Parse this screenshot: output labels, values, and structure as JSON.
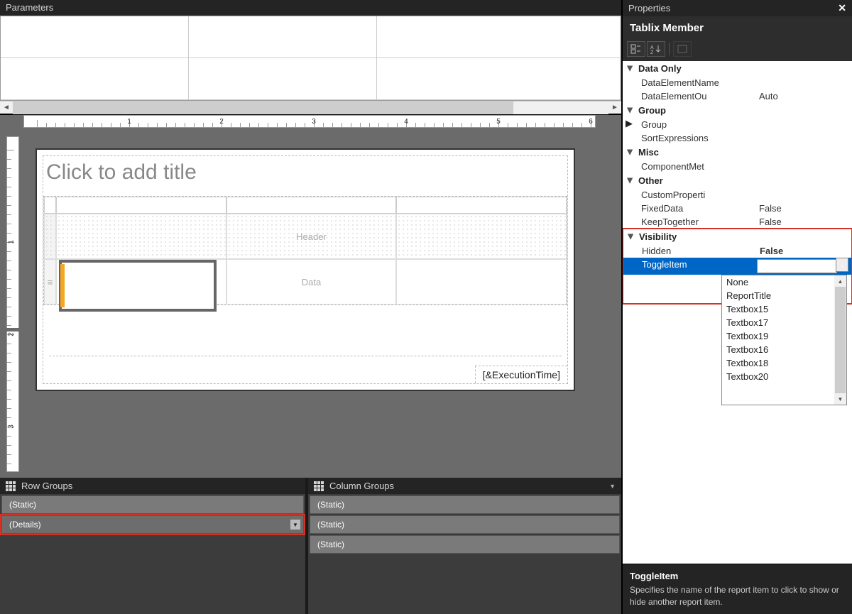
{
  "parameters": {
    "title": "Parameters"
  },
  "design": {
    "title_placeholder": "Click to add title",
    "header_label": "Header",
    "data_label": "Data",
    "exec_time": "[&ExecutionTime]"
  },
  "row_groups": {
    "title": "Row Groups",
    "items": [
      "(Static)",
      "(Details)"
    ]
  },
  "col_groups": {
    "title": "Column Groups",
    "items": [
      "(Static)",
      "(Static)",
      "(Static)"
    ]
  },
  "properties": {
    "title": "Properties",
    "object": "Tablix Member",
    "categories": [
      {
        "name": "Data Only",
        "open": true,
        "props": [
          {
            "k": "DataElementName",
            "v": ""
          },
          {
            "k": "DataElementOutput",
            "kshort": "DataElementOu",
            "v": "Auto"
          }
        ]
      },
      {
        "name": "Group",
        "open": true,
        "props": [
          {
            "k": "Group",
            "v": "",
            "expand": "right"
          },
          {
            "k": "SortExpressions",
            "v": ""
          }
        ]
      },
      {
        "name": "Misc",
        "open": true,
        "props": [
          {
            "k": "ComponentMetadata",
            "kshort": "ComponentMet",
            "v": ""
          }
        ]
      },
      {
        "name": "Other",
        "open": true,
        "props": [
          {
            "k": "CustomProperties",
            "kshort": "CustomProperti",
            "v": ""
          },
          {
            "k": "FixedData",
            "v": "False"
          },
          {
            "k": "KeepTogether",
            "v": "False"
          }
        ]
      },
      {
        "name": "Visibility",
        "open": true,
        "highlighted": true,
        "props": [
          {
            "k": "Hidden",
            "v": "False",
            "bold": true
          },
          {
            "k": "ToggleItem",
            "v": "",
            "selected": true
          }
        ]
      }
    ],
    "dropdown": [
      "None",
      "ReportTitle",
      "Textbox15",
      "Textbox17",
      "Textbox19",
      "Textbox16",
      "Textbox18",
      "Textbox20"
    ],
    "desc_title": "ToggleItem",
    "desc_body": "Specifies the name of the report item to click to show or hide another report item."
  }
}
